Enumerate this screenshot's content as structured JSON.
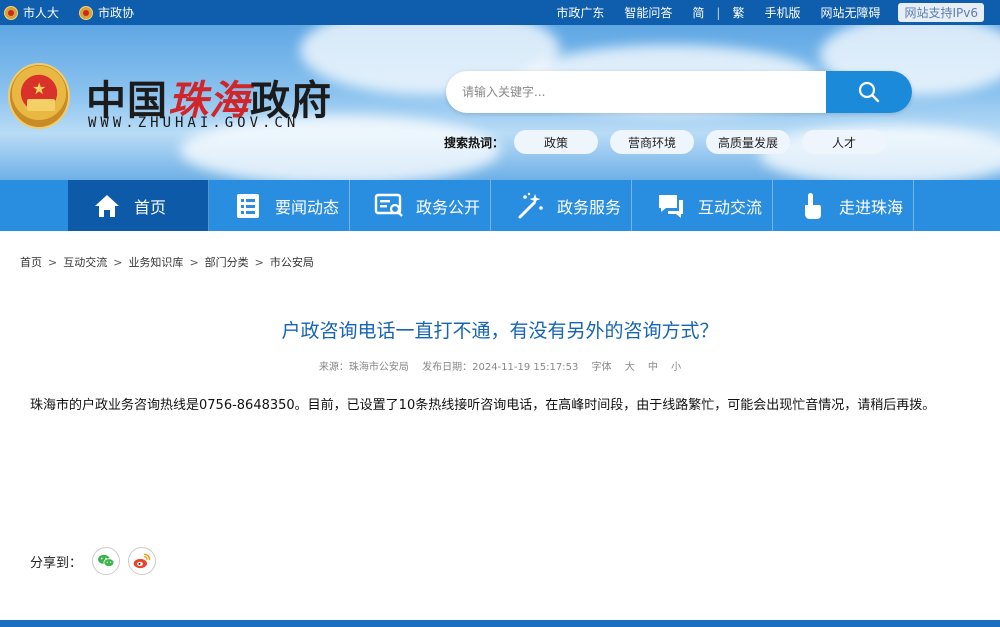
{
  "topbar": {
    "links_left": [
      "市人大",
      "市政协"
    ],
    "links_right": [
      "市政广东",
      "智能问答",
      "简",
      "繁",
      "手机版",
      "网站无障碍"
    ],
    "ipv6": "网站支持IPv6"
  },
  "header": {
    "title_part1": "中国",
    "title_part2": "珠海",
    "title_part3": "政府",
    "url": "WWW.ZHUHAI.GOV.CN",
    "search_placeholder": "请输入关键字...",
    "hot_label": "搜索热词：",
    "hot_tags": [
      "政策",
      "营商环境",
      "高质量发展",
      "人才"
    ]
  },
  "nav": {
    "items": [
      "首页",
      "要闻动态",
      "政务公开",
      "政务服务",
      "互动交流",
      "走进珠海"
    ]
  },
  "breadcrumb": [
    "首页",
    "互动交流",
    "业务知识库",
    "部门分类",
    "市公安局"
  ],
  "article": {
    "title": "户政咨询电话一直打不通，有没有另外的咨询方式？",
    "source": "来源：珠海市公安局",
    "date": "发布日期：2024-11-19 15:17:53",
    "font_label": "字体",
    "font_sizes": [
      "大",
      "中",
      "小"
    ],
    "body": "珠海市的户政业务咨询热线是0756-8648350。目前，已设置了10条热线接听咨询电话，在高峰时间段，由于线路繁忙，可能会出现忙音情况，请稍后再拨。"
  },
  "share": {
    "label": "分享到："
  },
  "colors": {
    "primary": "#2a8ee0",
    "nav_active": "#0d5aa8",
    "title": "#1665b4",
    "accent_red": "#d0252a"
  }
}
